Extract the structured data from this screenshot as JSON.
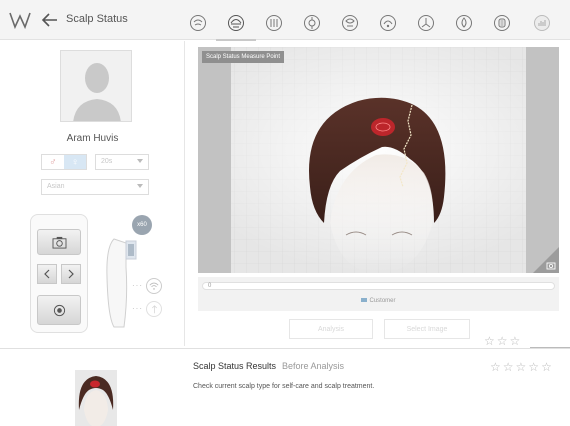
{
  "header": {
    "title": "Scalp Status",
    "tabs": [
      {
        "icon": "scalp-overview-icon"
      },
      {
        "icon": "scalp-status-icon",
        "active": true
      },
      {
        "icon": "hair-density-icon"
      },
      {
        "icon": "scalp-keratin-icon"
      },
      {
        "icon": "scalp-sensitivity-icon"
      },
      {
        "icon": "scalp-sebum-icon"
      },
      {
        "icon": "hair-loss-icon"
      },
      {
        "icon": "scalp-moisture-icon"
      },
      {
        "icon": "hair-thickness-icon"
      },
      {
        "icon": "report-chart-icon"
      }
    ]
  },
  "profile": {
    "name": "Aram Huvis",
    "gender_male": "♂",
    "gender_female": "♀",
    "age_select": "20s",
    "region_select": "Asian"
  },
  "device": {
    "magnification": "x60"
  },
  "viewer": {
    "label": "Scalp Status Measure Point"
  },
  "slider": {
    "value": "0",
    "legend": "Customer"
  },
  "actions": {
    "analysis_label": "Analysis",
    "select_image_label": "Select Image"
  },
  "results": {
    "title": "Scalp Status Results",
    "subtitle": "Before Analysis",
    "description": "Check current scalp type for self-care and scalp treatment."
  },
  "ratings": {
    "small_stars": 3,
    "large_stars": 5,
    "star_glyph": "☆"
  },
  "colors": {
    "hair": "#4a2a22",
    "measure_point": "#c8262c",
    "accent_blue": "#d8e7f4"
  }
}
